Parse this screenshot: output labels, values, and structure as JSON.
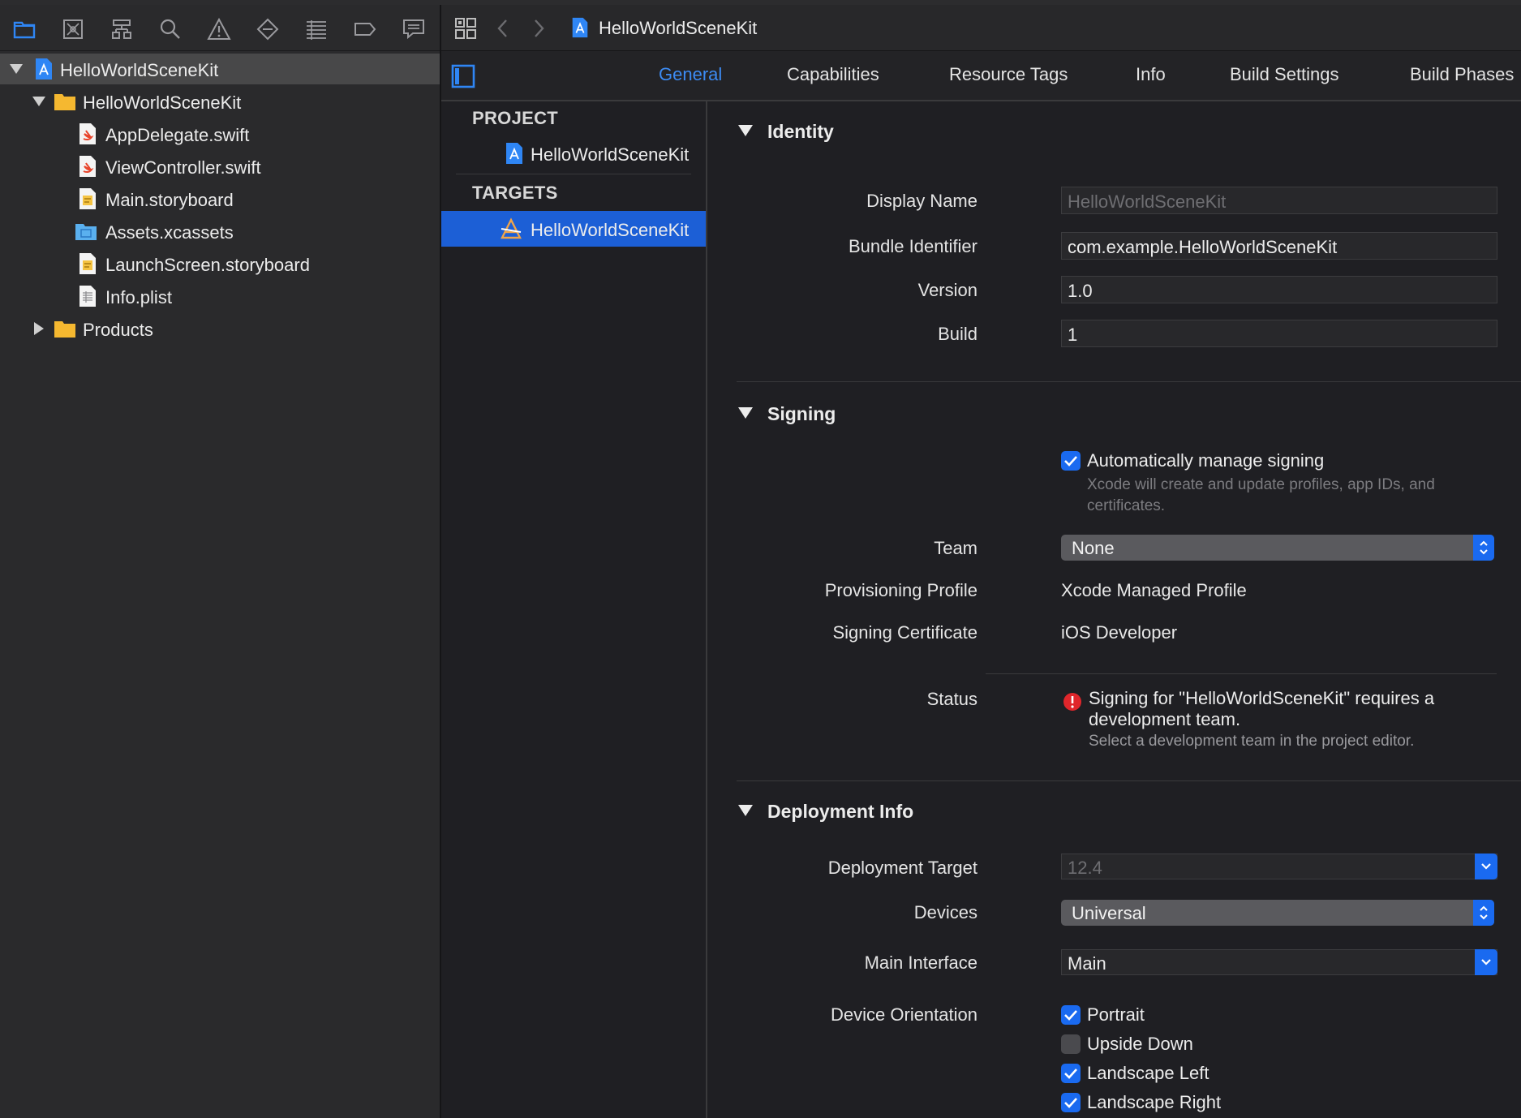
{
  "navigator": {
    "toolbar_icons": [
      "folder-icon",
      "source-control-icon",
      "hierarchy-icon",
      "search-icon",
      "warning-icon",
      "test-diamond-icon",
      "debug-list-icon",
      "breakpoint-icon",
      "report-icon"
    ],
    "tree": [
      {
        "label": "HelloWorldSceneKit",
        "kind": "project",
        "level": 0,
        "expanded": true,
        "selected": true
      },
      {
        "label": "HelloWorldSceneKit",
        "kind": "folder",
        "level": 1,
        "expanded": true
      },
      {
        "label": "AppDelegate.swift",
        "kind": "swift",
        "level": 2
      },
      {
        "label": "ViewController.swift",
        "kind": "swift",
        "level": 2
      },
      {
        "label": "Main.storyboard",
        "kind": "storyboard",
        "level": 2
      },
      {
        "label": "Assets.xcassets",
        "kind": "assets",
        "level": 2
      },
      {
        "label": "LaunchScreen.storyboard",
        "kind": "storyboard",
        "level": 2
      },
      {
        "label": "Info.plist",
        "kind": "plist",
        "level": 2
      },
      {
        "label": "Products",
        "kind": "folder",
        "level": 1,
        "expanded": false
      }
    ]
  },
  "editor": {
    "breadcrumb": "HelloWorldSceneKit",
    "tabs": [
      "General",
      "Capabilities",
      "Resource Tags",
      "Info",
      "Build Settings",
      "Build Phases"
    ],
    "active_tab": "General"
  },
  "target_list": {
    "project_header": "PROJECT",
    "project_item": "HelloWorldSceneKit",
    "targets_header": "TARGETS",
    "target_item": "HelloWorldSceneKit"
  },
  "identity": {
    "title": "Identity",
    "display_name_label": "Display Name",
    "display_name_placeholder": "HelloWorldSceneKit",
    "bundle_id_label": "Bundle Identifier",
    "bundle_id": "com.example.HelloWorldSceneKit",
    "version_label": "Version",
    "version": "1.0",
    "build_label": "Build",
    "build": "1"
  },
  "signing": {
    "title": "Signing",
    "auto_label": "Automatically manage signing",
    "auto_checked": true,
    "auto_hint": "Xcode will create and update profiles, app IDs, and certificates.",
    "team_label": "Team",
    "team": "None",
    "profile_label": "Provisioning Profile",
    "profile": "Xcode Managed Profile",
    "certificate_label": "Signing Certificate",
    "certificate": "iOS Developer",
    "status_label": "Status",
    "status_message": "Signing for \"HelloWorldSceneKit\" requires a development team.",
    "status_hint": "Select a development team in the project editor."
  },
  "deployment": {
    "title": "Deployment Info",
    "target_label": "Deployment Target",
    "target": "12.4",
    "devices_label": "Devices",
    "devices": "Universal",
    "main_interface_label": "Main Interface",
    "main_interface": "Main",
    "orientation_label": "Device Orientation",
    "orientations": [
      {
        "label": "Portrait",
        "checked": true
      },
      {
        "label": "Upside Down",
        "checked": false
      },
      {
        "label": "Landscape Left",
        "checked": true
      },
      {
        "label": "Landscape Right",
        "checked": true
      }
    ]
  },
  "colors": {
    "accent": "#1a6af0",
    "accent_text": "#3c8bf3",
    "error": "#e0262b",
    "folder": "#f5b830"
  }
}
